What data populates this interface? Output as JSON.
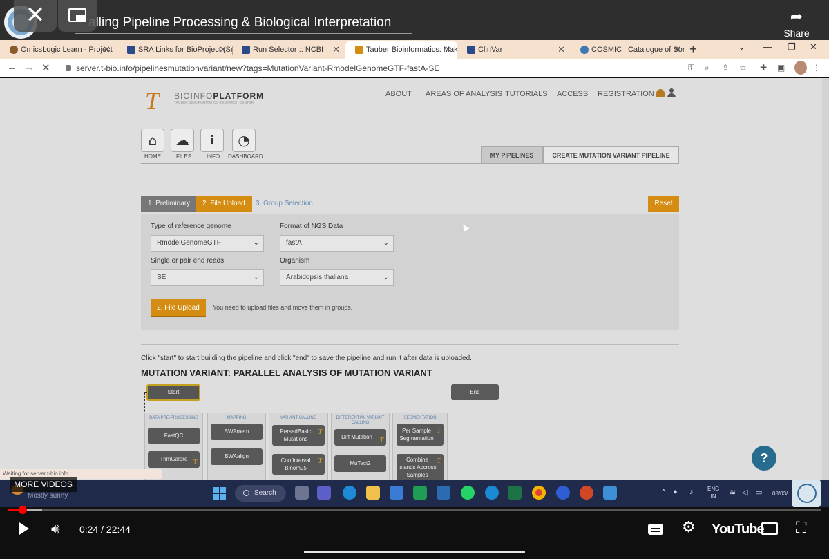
{
  "video": {
    "title": "alling Pipeline Processing & Biological Interpretation",
    "share_label": "Share",
    "more_videos_label": "MORE VIDEOS",
    "time_display": "0:24 / 22:44",
    "progress_fraction": 0.018,
    "buffer_fraction": 0.042,
    "brand": "YouTube"
  },
  "browser": {
    "tabs": [
      {
        "label": "OmicsLogic Learn - Project",
        "icon_color": "#8b5a2b"
      },
      {
        "label": "SRA Links for BioProject (Se",
        "icon_color": "#2a4a8a"
      },
      {
        "label": "Run Selector :: NCBI",
        "icon_color": "#2a4a8a"
      },
      {
        "label": "Tauber Bioinformatics: Mak",
        "icon_color": "#d58c12"
      },
      {
        "label": "ClinVar",
        "icon_color": "#2a4a8a"
      },
      {
        "label": "COSMIC | Catalogue of Sor",
        "icon_color": "#3d7ab5"
      }
    ],
    "url": "server.t-bio.info/pipelinesmutationvariant/new?tags=MutationVariant-RmodelGenomeGTF-fastA-SE"
  },
  "site": {
    "logo_letter": "T",
    "logo_name_light": "BIOINFO",
    "logo_name_bold": "PLATFORM",
    "logo_tagline": "TAUBER BIOINFORMATICS RESEARCH CENTER",
    "nav": [
      "ABOUT",
      "AREAS OF ANALYSIS",
      "TUTORIALS",
      "ACCESS",
      "REGISTRATION"
    ],
    "icon_buttons": [
      {
        "label": "HOME",
        "icon": "home-icon"
      },
      {
        "label": "FILES",
        "icon": "upload-cloud-icon"
      },
      {
        "label": "INFO",
        "icon": "info-icon"
      },
      {
        "label": "DASHBOARD",
        "icon": "dashboard-icon"
      }
    ],
    "pipeline_tabs": [
      "MY PIPELINES",
      "CREATE MUTATION VARIANT PIPELINE"
    ]
  },
  "wizard": {
    "steps": [
      "1. Preliminary",
      "2. File Upload",
      "3. Group Selection"
    ],
    "active_step": 1,
    "reset_label": "Reset",
    "fields": {
      "genome_label": "Type of reference genome",
      "genome_value": "RmodelGenomeGTF",
      "format_label": "Format of NGS Data",
      "format_value": "fastA",
      "reads_label": "Single or pair end reads",
      "reads_value": "SE",
      "organism_label": "Organism",
      "organism_value": "Arabidopsis thaliana"
    },
    "upload_button": "2. File Upload",
    "upload_message": "You need to upload files and move them in groups."
  },
  "builder": {
    "help_text": "Click \"start\" to start building the pipeline and click \"end\" to save the pipeline and run it after data is uploaded.",
    "title": "MUTATION VARIANT: PARALLEL ANALYSIS OF MUTATION VARIANT",
    "start_label": "Start",
    "end_label": "End",
    "columns": [
      {
        "heading": "DATA PRE-PROCESSING",
        "nodes": [
          "FastQC",
          "TrimGalore"
        ]
      },
      {
        "heading": "MAPPING",
        "nodes": [
          "BWAmem",
          "BWAalign"
        ]
      },
      {
        "heading": "VARIANT CALLING",
        "nodes": [
          "PersadBasic Mutations",
          "Confinterval Binom95"
        ]
      },
      {
        "heading": "DIFFERENTIAL VARIANT CALLING",
        "nodes": [
          "Diff Mutation",
          "MuTect2"
        ]
      },
      {
        "heading": "SEGMENTATION",
        "nodes": [
          "Per Sample Segmentation",
          "Combine Islands Accross Samples"
        ]
      }
    ],
    "help_button": "?",
    "status": "Waiting for server.t-bio.info..."
  },
  "taskbar": {
    "weather": "Mostly sunny",
    "search_label": "Search",
    "lang_line1": "ENG",
    "lang_line2": "IN",
    "date": "08/03/"
  }
}
